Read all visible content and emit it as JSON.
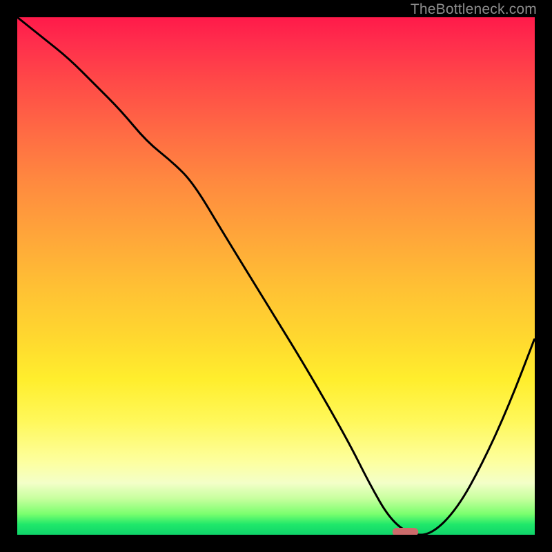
{
  "watermark": "TheBottleneck.com",
  "chart_data": {
    "type": "line",
    "title": "",
    "xlabel": "",
    "ylabel": "",
    "xlim": [
      0,
      100
    ],
    "ylim": [
      0,
      100
    ],
    "series": [
      {
        "name": "bottleneck-curve",
        "x": [
          0,
          5,
          10,
          15,
          20,
          25,
          30,
          34,
          40,
          48,
          56,
          64,
          68,
          72,
          76,
          80,
          85,
          90,
          95,
          100
        ],
        "values": [
          100,
          96,
          92,
          87,
          82,
          76,
          72,
          68,
          58,
          45,
          32,
          18,
          10,
          3,
          0,
          0,
          5,
          14,
          25,
          38
        ]
      }
    ],
    "marker": {
      "name": "optimal-region",
      "x_center_pct": 75,
      "width_pct": 5
    },
    "background_gradient": {
      "stops": [
        {
          "pos": 0,
          "color": "#ff1a4a"
        },
        {
          "pos": 12,
          "color": "#ff4848"
        },
        {
          "pos": 32,
          "color": "#ff8a3f"
        },
        {
          "pos": 52,
          "color": "#ffc034"
        },
        {
          "pos": 70,
          "color": "#ffee2d"
        },
        {
          "pos": 86,
          "color": "#fdffa0"
        },
        {
          "pos": 96,
          "color": "#7aff6e"
        },
        {
          "pos": 100,
          "color": "#0fd46a"
        }
      ]
    }
  }
}
